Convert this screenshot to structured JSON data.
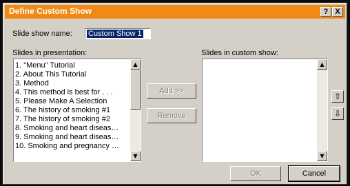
{
  "window": {
    "title": "Define Custom Show",
    "help_label": "?",
    "close_label": "X"
  },
  "show_name": {
    "label": "Slide show name:",
    "value": "Custom Show 1"
  },
  "slides_in_presentation": {
    "label": "Slides in presentation:",
    "items": [
      "1. \"Menu\" Tutorial",
      "2. About This Tutorial",
      "3. Method",
      "4. This method is best for . . .",
      "5. Please Make A Selection",
      "6. The history of smoking #1",
      "7. The history of smoking #2",
      "8. Smoking and heart diseas…",
      "9. Smoking and heart diseas…",
      "10. Smoking and pregnancy …"
    ]
  },
  "slides_in_custom_show": {
    "label": "Slides in custom show:",
    "items": []
  },
  "buttons": {
    "add": "Add >>",
    "remove": "Remove",
    "ok": "OK",
    "cancel": "Cancel",
    "move_up_icon": "up-arrow",
    "move_down_icon": "down-arrow"
  },
  "colors": {
    "title_bar": "#f08a14",
    "dialog_bg": "#d4d0c8",
    "selection": "#0a246a"
  }
}
